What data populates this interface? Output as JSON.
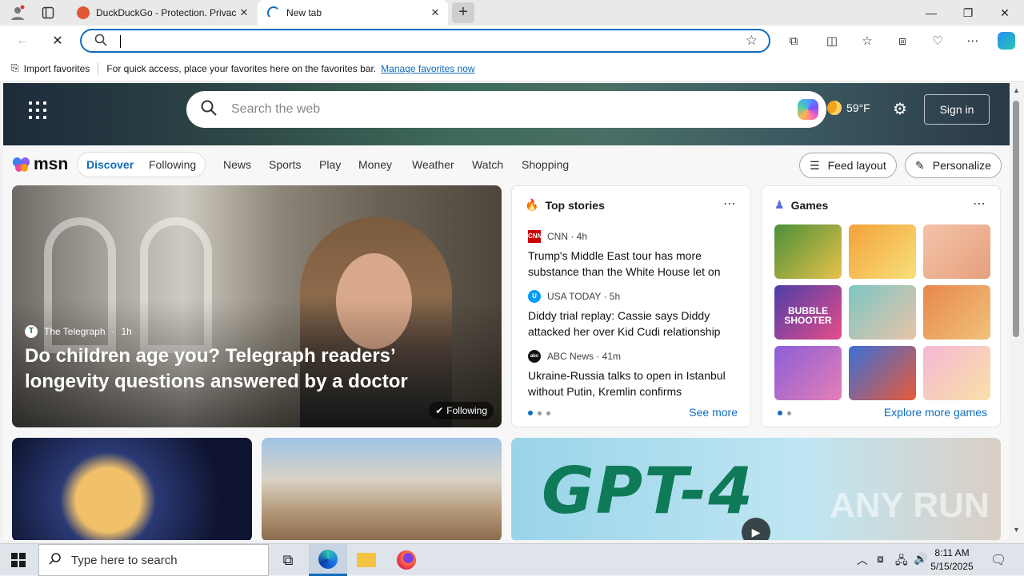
{
  "browser": {
    "tabs": [
      {
        "title": "DuckDuckGo - Protection. Privacy",
        "active": false
      },
      {
        "title": "New tab",
        "active": true
      }
    ],
    "address_value": "",
    "window_controls": [
      "minimize-icon",
      "restore-icon",
      "close-icon"
    ]
  },
  "favbar": {
    "import_label": "Import favorites",
    "hint": "For quick access, place your favorites here on the favorites bar.",
    "manage_link": "Manage favorites now"
  },
  "msn": {
    "search_placeholder": "Search the web",
    "weather_temp": "59°F",
    "signin": "Sign in",
    "logo": "msn",
    "tabs": [
      "Discover",
      "Following"
    ],
    "nav": [
      "News",
      "Sports",
      "Play",
      "Money",
      "Weather",
      "Watch",
      "Shopping"
    ],
    "feed_layout": "Feed layout",
    "personalize": "Personalize"
  },
  "hero": {
    "source": "The Telegraph",
    "age": "1h",
    "headline": "Do children age you? Telegraph readers’ longevity questions answered by a doctor",
    "following": "Following"
  },
  "top_stories": {
    "title": "Top stories",
    "items": [
      {
        "source": "CNN · 4h",
        "logo": "CNN",
        "color": "#cc0000",
        "headline": "Trump's Middle East tour has more substance than the White House let on"
      },
      {
        "source": "USA TODAY · 5h",
        "logo": "U",
        "color": "#009bff",
        "headline": "Diddy trial replay: Cassie says Diddy attacked her over Kid Cudi relationship"
      },
      {
        "source": "ABC News · 41m",
        "logo": "abc",
        "color": "#111111",
        "headline": "Ukraine-Russia talks to open in Istanbul without Putin, Kremlin confirms"
      }
    ],
    "see_more": "See more"
  },
  "games": {
    "title": "Games",
    "tiles": [
      {
        "name": "pin-puzzle-game",
        "colors": [
          "#4a8f3a",
          "#e8c24a"
        ]
      },
      {
        "name": "cupcake-game",
        "colors": [
          "#f4a13a",
          "#f7e07a"
        ]
      },
      {
        "name": "dress-up-game",
        "colors": [
          "#f3c3a9",
          "#e6a07d"
        ]
      },
      {
        "name": "bubble-shooter-game",
        "colors": [
          "#4c3fa8",
          "#e74c8a"
        ]
      },
      {
        "name": "hospital-game",
        "colors": [
          "#7cc7c4",
          "#e9c3a8"
        ]
      },
      {
        "name": "toy-shop-game",
        "colors": [
          "#e7874e",
          "#f1c27a"
        ]
      },
      {
        "name": "makeup-game",
        "colors": [
          "#8c5ed8",
          "#e67eb6"
        ]
      },
      {
        "name": "shark-game",
        "colors": [
          "#3a6fd8",
          "#e85a3a"
        ]
      },
      {
        "name": "princess-game",
        "colors": [
          "#f5b8d4",
          "#f9e0a8"
        ]
      }
    ],
    "bubble_label": "BUBBLE SHOOTER",
    "explore": "Explore more games"
  },
  "video": {
    "title_art": "GPT-4",
    "watermark": "ANY RUN"
  },
  "taskbar": {
    "search_placeholder": "Type here to search",
    "time": "8:11 AM",
    "date": "5/15/2025"
  }
}
